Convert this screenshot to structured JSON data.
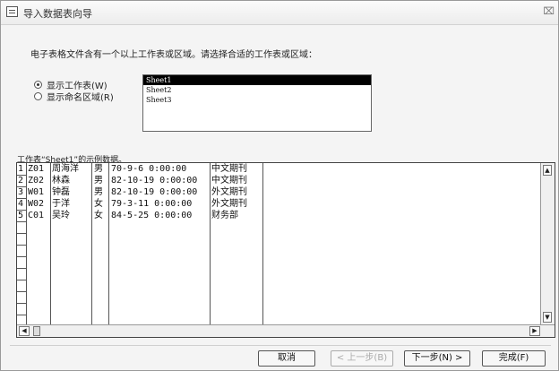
{
  "window": {
    "title": "导入数据表向导",
    "close_glyph": "⌧"
  },
  "prompt": "电子表格文件含有一个以上工作表或区域。请选择合适的工作表或区域：",
  "options": [
    {
      "label": "显示工作表(W)",
      "checked": true
    },
    {
      "label": "显示命名区域(R)",
      "checked": false
    }
  ],
  "sheets": [
    "Sheet1",
    "Sheet2",
    "Sheet3"
  ],
  "selected_sheet": "Sheet1",
  "preview_label": "工作表“Sheet1”的示例数据。",
  "rows": [
    {
      "num": "1",
      "id": "Z01",
      "name": "周海洋",
      "gender": "男",
      "date": "70-9-6 0:00:00",
      "category": "中文期刊"
    },
    {
      "num": "2",
      "id": "Z02",
      "name": "林森",
      "gender": "男",
      "date": "82-10-19 0:00:00",
      "category": "中文期刊"
    },
    {
      "num": "3",
      "id": "W01",
      "name": "钟磊",
      "gender": "男",
      "date": "82-10-19 0:00:00",
      "category": "外文期刊"
    },
    {
      "num": "4",
      "id": "W02",
      "name": "于洋",
      "gender": "女",
      "date": "79-3-11 0:00:00",
      "category": "外文期刊"
    },
    {
      "num": "5",
      "id": "C01",
      "name": "吴玲",
      "gender": "女",
      "date": "84-5-25 0:00:00",
      "category": "财务部"
    }
  ],
  "buttons": {
    "cancel": "取消",
    "back": "< 上一步(B)",
    "next": "下一步(N) >",
    "finish": "完成(F)"
  }
}
